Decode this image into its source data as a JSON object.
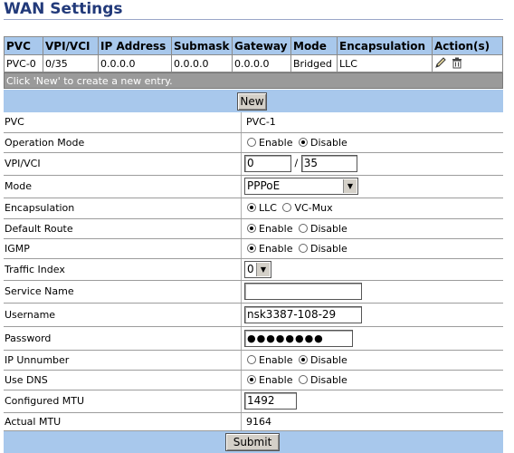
{
  "page": {
    "title": "WAN Settings"
  },
  "overview": {
    "headers": [
      "PVC",
      "VPI/VCI",
      "IP Address",
      "Submask",
      "Gateway",
      "Mode",
      "Encapsulation",
      "Action(s)"
    ],
    "rows": [
      {
        "pvc": "PVC-0",
        "vpivci": "0/35",
        "ip": "0.0.0.0",
        "submask": "0.0.0.0",
        "gateway": "0.0.0.0",
        "mode": "Bridged",
        "encap": "LLC",
        "edit_icon": "pencil-icon",
        "delete_icon": "trash-icon"
      }
    ],
    "hint": "Click 'New' to create a new entry.",
    "new_label": "New"
  },
  "form": {
    "pvc": {
      "label": "PVC",
      "value": "PVC-1"
    },
    "operation_mode": {
      "label": "Operation Mode",
      "opt1": "Enable",
      "opt2": "Disable",
      "selected": "Disable"
    },
    "vpivci": {
      "label": "VPI/VCI",
      "vpi": "0",
      "sep": "/",
      "vci": "35"
    },
    "mode": {
      "label": "Mode",
      "value": "PPPoE"
    },
    "encapsulation": {
      "label": "Encapsulation",
      "opt1": "LLC",
      "opt2": "VC-Mux",
      "selected": "LLC"
    },
    "default_route": {
      "label": "Default Route",
      "opt1": "Enable",
      "opt2": "Disable",
      "selected": "Enable"
    },
    "igmp": {
      "label": "IGMP",
      "opt1": "Enable",
      "opt2": "Disable",
      "selected": "Enable"
    },
    "traffic_index": {
      "label": "Traffic Index",
      "value": "0"
    },
    "service_name": {
      "label": "Service Name",
      "value": ""
    },
    "username": {
      "label": "Username",
      "value": "nsk3387-108-29"
    },
    "password": {
      "label": "Password",
      "value": "●●●●●●●●"
    },
    "ip_unnumber": {
      "label": "IP Unnumber",
      "opt1": "Enable",
      "opt2": "Disable",
      "selected": "Disable"
    },
    "use_dns": {
      "label": "Use DNS",
      "opt1": "Enable",
      "opt2": "Disable",
      "selected": "Enable"
    },
    "configured_mtu": {
      "label": "Configured MTU",
      "value": "1492"
    },
    "actual_mtu": {
      "label": "Actual MTU",
      "value": "9164"
    },
    "submit_label": "Submit"
  },
  "colors": {
    "header_bg": "#a8c8ec",
    "title": "#223a7a",
    "hint_bg": "#9a9a9a"
  }
}
